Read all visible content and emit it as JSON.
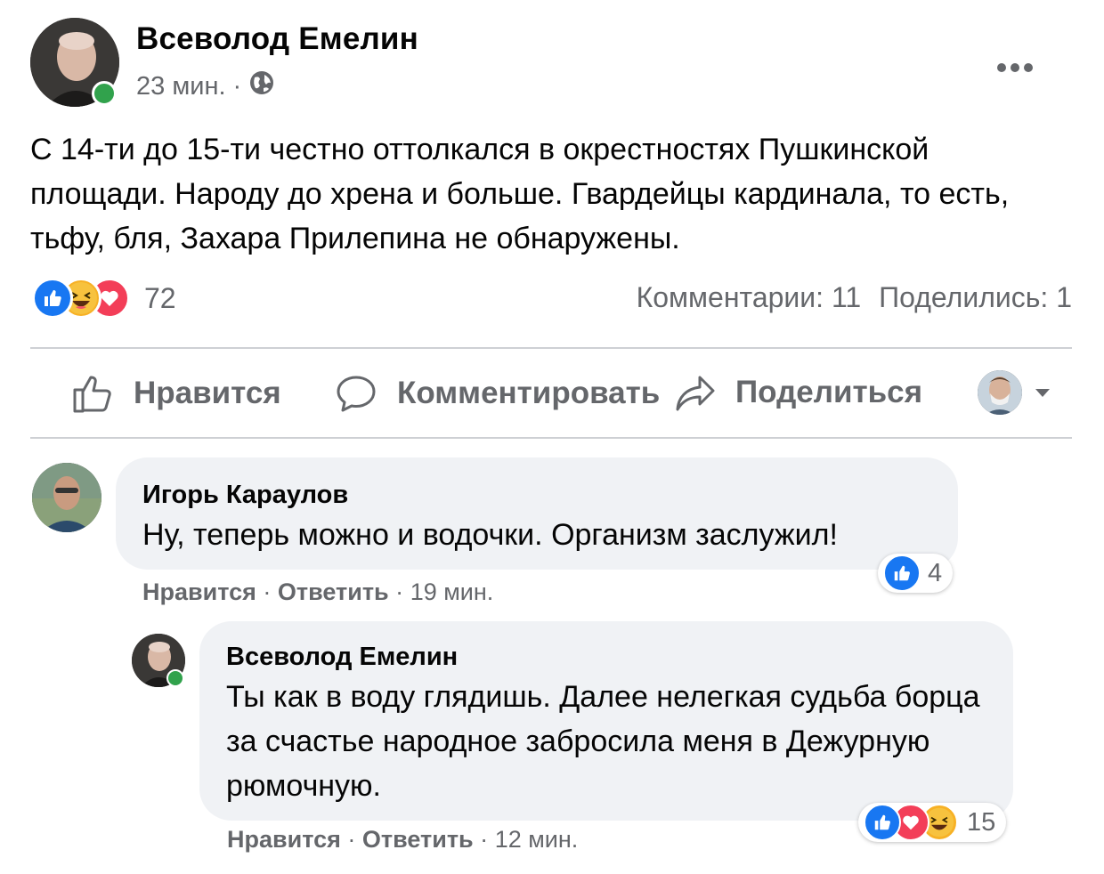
{
  "post": {
    "author": "Всеволод Емелин",
    "time": "23 мин.",
    "separator": "·",
    "privacy_icon": "globe-icon",
    "more_icon": "ellipsis-icon",
    "text": "С 14-ти до 15-ти честно оттолкался в окрестностях Пушкинской площади. Народу до хрена и больше.  Гвардейцы кардинала, то есть, тьфу,  бля, Захара Прилепина не обнаружены.",
    "reactions": {
      "icons": [
        "like",
        "haha",
        "love"
      ],
      "count": "72"
    },
    "comments_count": "Комментарии: 11",
    "shares_count": "Поделились: 1"
  },
  "actions": {
    "like": "Нравится",
    "comment": "Комментировать",
    "share": "Поделиться"
  },
  "comments": [
    {
      "author": "Игорь Караулов",
      "text": "Ну, теперь можно и водочки. Организм заслужил!",
      "like": "Нравится",
      "reply": "Ответить",
      "time": "19 мин.",
      "reactions_count": "4",
      "sep": "·"
    },
    {
      "author": "Всеволод Емелин",
      "text": "Ты как в воду глядишь. Далее нелегкая судьба борца за счастье народное забросила меня в Дежурную рюмочную.",
      "like": "Нравится",
      "reply": "Ответить",
      "time": "12 мин.",
      "reactions_count": "15",
      "sep": "·"
    }
  ],
  "colors": {
    "like_blue": "#1877f2",
    "love_red": "#f33e58",
    "haha_yellow": "#f7b125",
    "online_green": "#31a24c",
    "secondary_text": "#65676b"
  }
}
